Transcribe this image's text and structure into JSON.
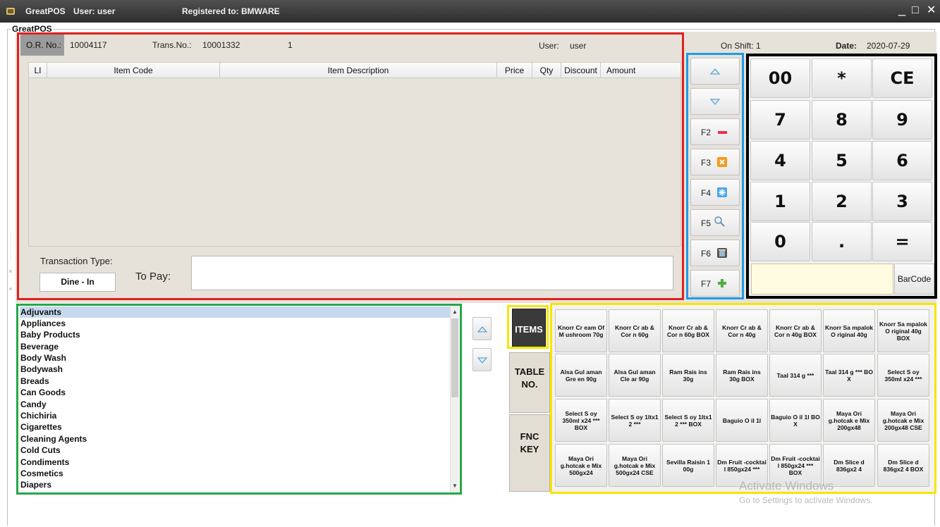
{
  "window": {
    "title": "GreatPOS",
    "user_label": "User: user",
    "registered": "Registered to: BMWARE",
    "minimize": "_",
    "maximize": "□",
    "close": "✕"
  },
  "group_title": "GreatPOS",
  "info": {
    "or_label": "O.R. No.:",
    "or_value": "10004117",
    "trans_label": "Trans.No.:",
    "trans_value": "10001332",
    "count": "1",
    "user_label": "User:",
    "user_value": "user",
    "shift": "On Shift: 1",
    "date_label": "Date:",
    "date_value": "2020-07-29"
  },
  "table": {
    "columns": [
      "LI",
      "Item Code",
      "Item Description",
      "Price",
      "Qty",
      "Discount",
      "Amount"
    ],
    "rows": []
  },
  "transaction": {
    "type_label": "Transaction Type:",
    "type_value": "Dine - In",
    "pay_label": "To Pay:",
    "pay_value": ""
  },
  "fkeys": [
    {
      "label": "",
      "icon": "up-arrow-icon"
    },
    {
      "label": "",
      "icon": "down-arrow-icon"
    },
    {
      "label": "F2",
      "icon": "minus-icon"
    },
    {
      "label": "F3",
      "icon": "cancel-icon"
    },
    {
      "label": "F4",
      "icon": "snowflake-icon"
    },
    {
      "label": "F5",
      "icon": "search-icon"
    },
    {
      "label": "F6",
      "icon": "trash-icon"
    },
    {
      "label": "F7",
      "icon": "plus-icon"
    }
  ],
  "numpad": [
    "00",
    "*",
    "CE",
    "7",
    "8",
    "9",
    "4",
    "5",
    "6",
    "1",
    "2",
    "3",
    "0",
    ".",
    "="
  ],
  "barcode": {
    "label": "BarCode",
    "value": ""
  },
  "categories": [
    "Adjuvants",
    "Appliances",
    "Baby Products",
    "Beverage",
    "Body Wash",
    "Bodywash",
    "Breads",
    "Can Goods",
    "Candy",
    "Chichiria",
    "Cigarettes",
    "Cleaning Agents",
    "Cold Cuts",
    "Condiments",
    "Cosmetics",
    "Diapers"
  ],
  "selected_category": "Adjuvants",
  "tabs": {
    "items": "ITEMS",
    "table1": "TABLE",
    "table2": "NO.",
    "fnc1": "FNC",
    "fnc2": "KEY"
  },
  "products": [
    [
      "Knorr Cr eam Of M ushroom 70g",
      "Knorr Cr ab & Cor n 60g",
      "Knorr Cr ab & Cor n 60g BOX",
      "Knorr Cr ab & Cor n 40g",
      "Knorr Cr ab & Cor n 40g BOX",
      "Knorr Sa mpalok O riginal 40g",
      "Knorr Sa mpalok O riginal 40g BOX"
    ],
    [
      "Alsa Gul aman Gre en 90g",
      "Alsa Gul aman Cle ar 90g",
      "Ram Rais ins 30g",
      "Ram Rais ins 30g BOX",
      "Taal 314 g ***",
      "Taal 314 g *** BO X",
      "Select S oy 350ml x24 ***"
    ],
    [
      "Select S oy 350ml x24 *** BOX",
      "Select S oy 1ltx1 2 ***",
      "Select S oy 1ltx1 2 *** BOX",
      "Baguio O il 1l",
      "Baguio O il 1l BO X",
      "Maya Ori g.hotcak e Mix 200gx48",
      "Maya Ori g.hotcak e Mix 200gx48 CSE"
    ],
    [
      "Maya Ori g.hotcak e Mix 500gx24",
      "Maya Ori g.hotcak e Mix 500gx24 CSE",
      "Sevilla Raisin 1 00g",
      "Dm Fruit -cocktai l 850gx24 ***",
      "Dm Fruit -cocktai l 850gx24 *** BOX",
      "Dm Slice d 836gx2 4",
      "Dm Slice d 836gx2 4 BOX"
    ]
  ],
  "watermark": {
    "line1": "Activate Windows",
    "line2": "Go to Settings to activate Windows."
  },
  "colors": {
    "outline_red": "#e02020",
    "outline_blue": "#1e9be6",
    "outline_black": "#000000",
    "outline_green": "#25a84a",
    "outline_yellow": "#f5e600",
    "selected_row": "#c6d9ef",
    "items_tab": "#3a3a3a"
  }
}
